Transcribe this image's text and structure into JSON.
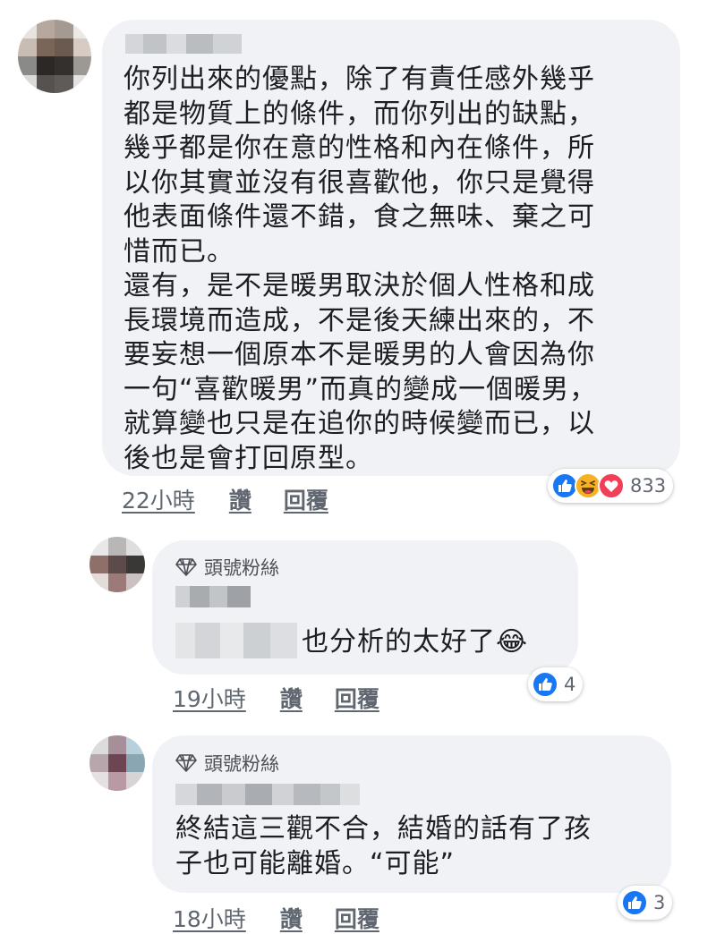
{
  "comments": [
    {
      "text": "你列出來的優點，除了有責任感外幾乎\n都是物質上的條件，而你列出的缺點，\n幾乎都是你在意的性格和內在條件，所\n以你其實並沒有很喜歡他，你只是覺得\n他表面條件還不錯，食之無味、棄之可\n惜而已。\n還有，是不是暖男取決於個人性格和成\n長環境而造成，不是後天練出來的，不\n要妄想一個原本不是暖男的人會因為你\n一句“喜歡暖男”而真的變成一個暖男，\n就算變也只是在追你的時候變而已，以\n後也是會打回原型。",
      "time": "22小時",
      "like_label": "讚",
      "reply_label": "回覆",
      "reaction_count": "833",
      "reaction_icons": [
        "like-icon",
        "haha-icon",
        "love-icon"
      ]
    },
    {
      "fan_badge": "頭號粉絲",
      "text": "也分析的太好了😂",
      "time": "19小時",
      "like_label": "讚",
      "reply_label": "回覆",
      "reaction_count": "4",
      "reaction_icons": [
        "like-icon"
      ]
    },
    {
      "fan_badge": "頭號粉絲",
      "text": "終結這三觀不合，結婚的話有了孩\n子也可能離婚。“可能”",
      "time": "18小時",
      "like_label": "讚",
      "reply_label": "回覆",
      "reaction_count": "3",
      "reaction_icons": [
        "like-icon"
      ]
    }
  ],
  "colors": {
    "bubble": "#f0f2f5",
    "like_blue": "#1877f2",
    "love_red": "#f33e58",
    "haha_yellow": "#f7b125",
    "meta_gray": "#606770"
  }
}
